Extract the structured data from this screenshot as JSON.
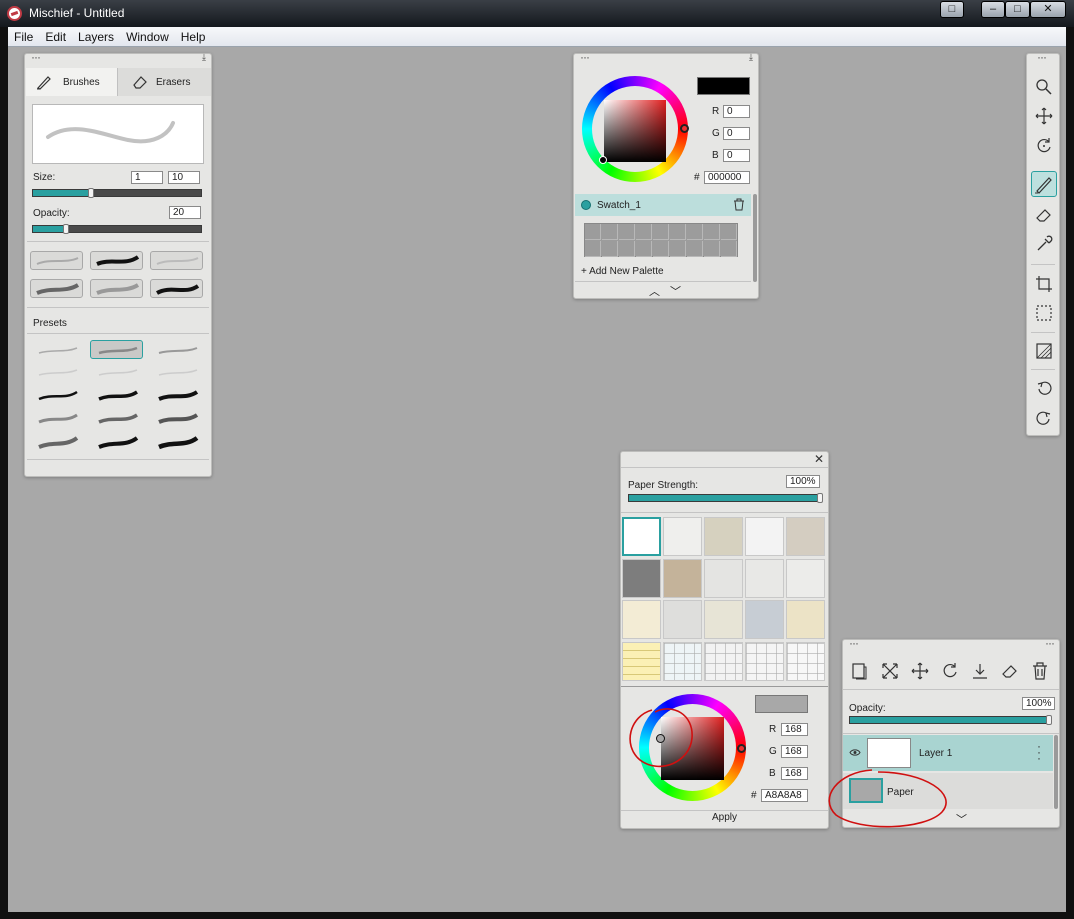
{
  "window": {
    "title": "Mischief - Untitled",
    "controls": [
      "□",
      "–",
      "□",
      "✕"
    ]
  },
  "menu": [
    "File",
    "Edit",
    "Layers",
    "Window",
    "Help"
  ],
  "brushes_panel": {
    "tabs": [
      {
        "label": "Brushes"
      },
      {
        "label": "Erasers"
      }
    ],
    "size_label": "Size:",
    "size_min": "1",
    "size_max": "10",
    "size_fraction": 0.35,
    "opacity_label": "Opacity:",
    "opacity_value": "20",
    "opacity_fraction": 0.2,
    "presets_label": "Presets"
  },
  "color_panel_top": {
    "r_label": "R",
    "r": "0",
    "g_label": "G",
    "g": "0",
    "b_label": "B",
    "b": "0",
    "hash": "#",
    "hex": "000000",
    "current_color": "#000000",
    "swatch_name": "Swatch_1",
    "add_palette": "+ Add New Palette"
  },
  "paper_panel": {
    "strength_label": "Paper Strength:",
    "strength_value": "100%",
    "strength_fraction": 1.0,
    "r_label": "R",
    "r": "168",
    "g_label": "G",
    "g": "168",
    "b_label": "B",
    "b": "168",
    "hash": "#",
    "hex": "A8A8A8",
    "current_color": "#a8a8a8",
    "apply_label": "Apply"
  },
  "layers_panel": {
    "opacity_label": "Opacity:",
    "opacity_value": "100%",
    "opacity_fraction": 1.0,
    "layers": [
      {
        "name": "Layer 1"
      },
      {
        "name": "Paper"
      }
    ]
  },
  "colors": {
    "accent": "#2aa0a0",
    "canvas": "#a8a8a8",
    "annotation": "#d01010"
  }
}
